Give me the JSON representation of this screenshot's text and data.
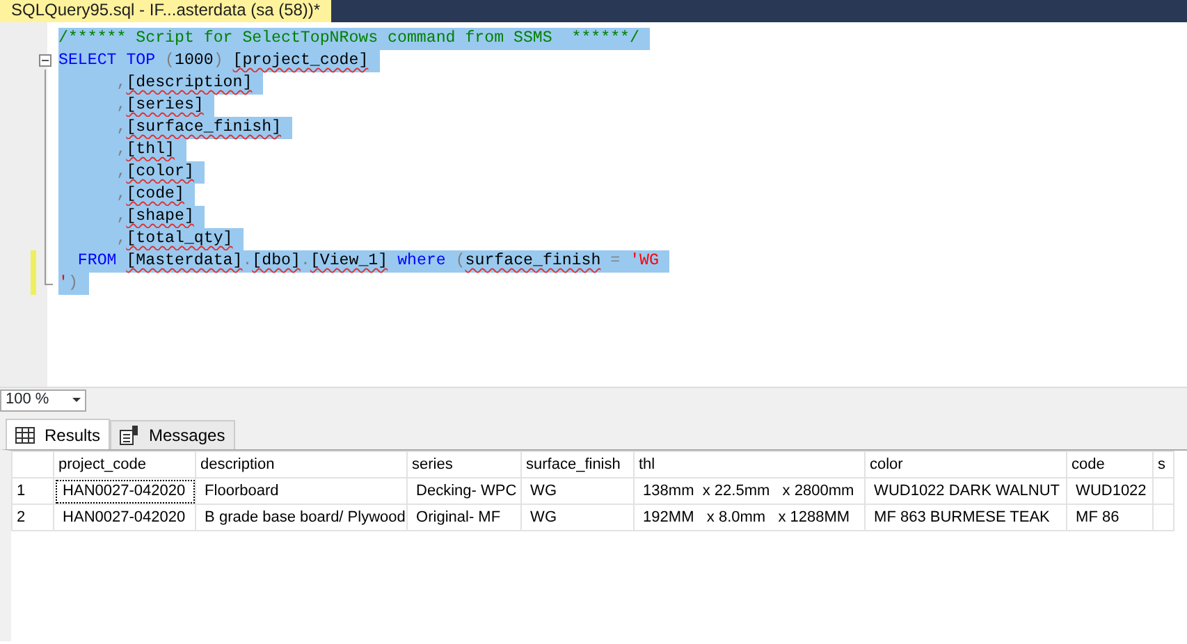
{
  "document_tab": {
    "title": "SQLQuery95.sql - IF...asterdata (sa (58))*"
  },
  "editor": {
    "lines": [
      {
        "modified": false,
        "fold": false,
        "tokens": [
          {
            "kind": "comment",
            "text": "/****** Script for SelectTopNRows command from SSMS  ******/"
          }
        ]
      },
      {
        "modified": false,
        "fold": true,
        "tokens": [
          {
            "kind": "keyword",
            "text": "SELECT TOP "
          },
          {
            "kind": "punct",
            "text": "("
          },
          {
            "kind": "plain",
            "text": "1000"
          },
          {
            "kind": "punct",
            "text": ") "
          },
          {
            "kind": "ident",
            "text": "[project_code]"
          }
        ]
      },
      {
        "modified": false,
        "fold": false,
        "tokens": [
          {
            "kind": "punct",
            "text": "      ,"
          },
          {
            "kind": "ident",
            "text": "[description]"
          }
        ]
      },
      {
        "modified": false,
        "fold": false,
        "tokens": [
          {
            "kind": "punct",
            "text": "      ,"
          },
          {
            "kind": "ident",
            "text": "[series]"
          }
        ]
      },
      {
        "modified": false,
        "fold": false,
        "tokens": [
          {
            "kind": "punct",
            "text": "      ,"
          },
          {
            "kind": "ident",
            "text": "[surface_finish]"
          }
        ]
      },
      {
        "modified": false,
        "fold": false,
        "tokens": [
          {
            "kind": "punct",
            "text": "      ,"
          },
          {
            "kind": "ident",
            "text": "[thl]"
          }
        ]
      },
      {
        "modified": false,
        "fold": false,
        "tokens": [
          {
            "kind": "punct",
            "text": "      ,"
          },
          {
            "kind": "ident",
            "text": "[color]"
          }
        ]
      },
      {
        "modified": false,
        "fold": false,
        "tokens": [
          {
            "kind": "punct",
            "text": "      ,"
          },
          {
            "kind": "ident",
            "text": "[code]"
          }
        ]
      },
      {
        "modified": false,
        "fold": false,
        "tokens": [
          {
            "kind": "punct",
            "text": "      ,"
          },
          {
            "kind": "ident",
            "text": "[shape]"
          }
        ]
      },
      {
        "modified": false,
        "fold": false,
        "tokens": [
          {
            "kind": "punct",
            "text": "      ,"
          },
          {
            "kind": "ident",
            "text": "[total_qty]"
          }
        ]
      },
      {
        "modified": true,
        "fold": false,
        "tokens": [
          {
            "kind": "keyword",
            "text": "  FROM "
          },
          {
            "kind": "ident",
            "text": "[Masterdata]"
          },
          {
            "kind": "punct",
            "text": "."
          },
          {
            "kind": "ident",
            "text": "[dbo]"
          },
          {
            "kind": "punct",
            "text": "."
          },
          {
            "kind": "ident",
            "text": "[View_1]"
          },
          {
            "kind": "keyword",
            "text": " where "
          },
          {
            "kind": "punct",
            "text": "("
          },
          {
            "kind": "ident",
            "text": "surface_finish"
          },
          {
            "kind": "punct",
            "text": " = "
          },
          {
            "kind": "string",
            "text": "'WG"
          }
        ]
      },
      {
        "modified": true,
        "fold": false,
        "tokens": [
          {
            "kind": "string",
            "text": "'"
          },
          {
            "kind": "punct",
            "text": ")"
          }
        ]
      }
    ]
  },
  "zoom": {
    "value": "100 %"
  },
  "result_tabs": [
    {
      "label": "Results",
      "kind": "grid",
      "selected": true
    },
    {
      "label": "Messages",
      "kind": "messages",
      "selected": false
    }
  ],
  "grid": {
    "columns": [
      "project_code",
      "description",
      "series",
      "surface_finish",
      "thl",
      "color",
      "code",
      "s"
    ],
    "rows": [
      {
        "number": "1",
        "focused": true,
        "cells": [
          "HAN0027-042020",
          "Floorboard",
          "Decking- WPC",
          "WG",
          "138mm  x 22.5mm   x 2800mm",
          "WUD1022 DARK WALNUT",
          "WUD1022"
        ]
      },
      {
        "number": "2",
        "focused": false,
        "cells": [
          "HAN0027-042020",
          "B grade base board/ Plywood",
          "Original- MF",
          "WG",
          "192MM   x 8.0mm   x 1288MM",
          "MF 863 BURMESE TEAK",
          "MF 86"
        ]
      }
    ]
  }
}
